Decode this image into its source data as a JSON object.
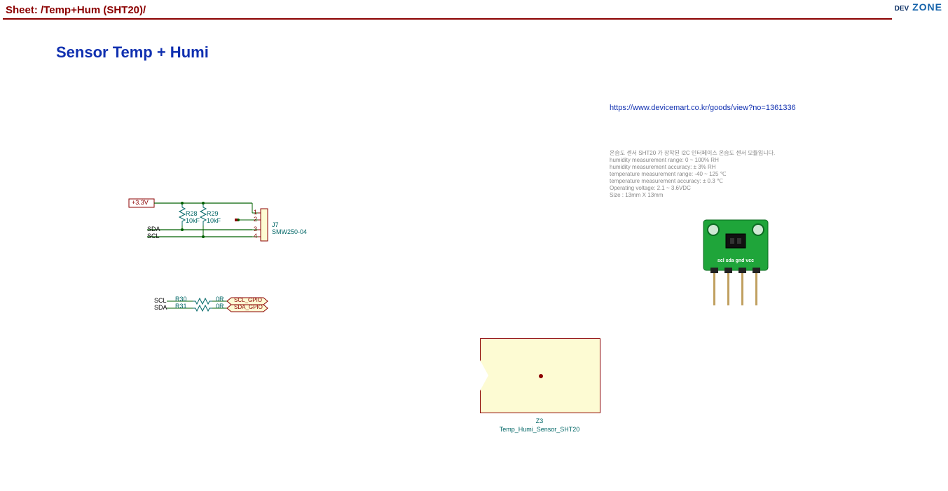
{
  "header": {
    "sheet_label": "Sheet: /Temp+Hum (SHT20)/",
    "logo_dev": "DEV",
    "logo_zone": "ZONE"
  },
  "title": "Sensor Temp + Humi",
  "link": "https://www.devicemart.co.kr/goods/view?no=1361336",
  "desc": {
    "l1": "온습도 센서 SHT20 가 장착된 I2C 인터페이스 온습도 센서 모듈입니다.",
    "l2": "humidity measurement range: 0 ~ 100% RH",
    "l3": "humidity measurement accuracy: ± 3% RH",
    "l4": "temperature measurement range: -40 ~ 125 ℃",
    "l5": "temperature measurement accuracy: ± 0.3 ℃",
    "l6": "Operating voltage: 2.1 ~ 3.6VDC",
    "l7": "Size : 13mm X 13mm"
  },
  "schematic": {
    "power": "+3.3V",
    "r28": {
      "ref": "R28",
      "val": "10kF"
    },
    "r29": {
      "ref": "R29",
      "val": "10kF"
    },
    "r30": {
      "ref": "R30",
      "val": "0R"
    },
    "r31": {
      "ref": "R31",
      "val": "0R"
    },
    "j7": {
      "ref": "J7",
      "val": "SMW250-04"
    },
    "pins": {
      "p1": "1",
      "p2": "2",
      "p3": "3",
      "p4": "4"
    },
    "sda": "SDA",
    "scl": "SCL",
    "scl_gpio": "SCL_GPIO",
    "sda_gpio": "SDA_GPIO"
  },
  "component": {
    "ref": "Z3",
    "val": "Temp_Humi_Sensor_SHT20"
  }
}
